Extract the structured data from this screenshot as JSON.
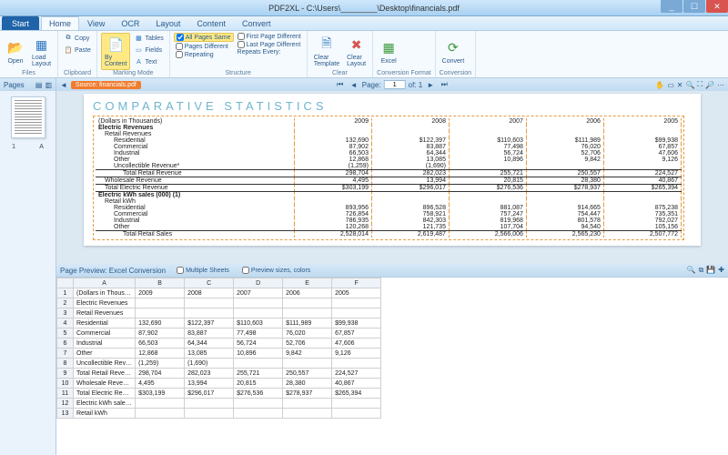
{
  "window": {
    "title": "PDF2XL - C:\\Users\\________\\Desktop\\financials.pdf",
    "min": "_",
    "max": "☐",
    "close": "✕"
  },
  "tabs": {
    "start": "Start",
    "items": [
      "Home",
      "View",
      "OCR",
      "Layout",
      "Content",
      "Convert"
    ],
    "active": 0
  },
  "ribbon": {
    "files": {
      "label": "Files",
      "open": "Open",
      "load": "Load\nLayout"
    },
    "clipboard": {
      "label": "Clipboard",
      "copy": "Copy",
      "paste": "Paste"
    },
    "marking": {
      "label": "Marking Mode",
      "by": "By\nContent",
      "tables": "Tables",
      "fields": "Fields",
      "text": "Text"
    },
    "structure": {
      "label": "Structure",
      "allSame": "All Pages Same",
      "firstDiff": "First Page Different",
      "pagesDiff": "Pages Different",
      "lastDiff": "Last Page Different",
      "repeating": "Repeating",
      "repeats": "Repeats Every:"
    },
    "clear": {
      "label": "Clear",
      "tmpl": "Clear\nTemplate",
      "layout": "Clear\nLayout"
    },
    "convfmt": {
      "label": "Conversion Format",
      "excel": "Excel"
    },
    "conv": {
      "label": "Conversion",
      "convert": "Convert"
    }
  },
  "side": {
    "title": "Pages",
    "t1": "1",
    "t2": "A"
  },
  "srcbar": {
    "source": "Source: financials.pdf",
    "pageLbl": "Page:",
    "page": "1",
    "of": "of: 1"
  },
  "doc": {
    "heading": "COMPARATIVE STATISTICS",
    "note": "(Dollars in Thousands)",
    "years": [
      "2009",
      "2008",
      "2007",
      "2006",
      "2005"
    ],
    "s1": "Electric Revenues",
    "s1a": "Retail Revenues",
    "rows1": [
      {
        "l": "Residential",
        "v": [
          "132,690",
          "$122,397",
          "$110,603",
          "$111,989",
          "$99,938"
        ]
      },
      {
        "l": "Commercial",
        "v": [
          "87,902",
          "83,887",
          "77,498",
          "76,020",
          "67,857"
        ]
      },
      {
        "l": "Industrial",
        "v": [
          "66,503",
          "64,344",
          "56,724",
          "52,706",
          "47,606"
        ]
      },
      {
        "l": "Other",
        "v": [
          "12,868",
          "13,085",
          "10,896",
          "9,842",
          "9,126"
        ]
      },
      {
        "l": "Uncollectible Revenue*",
        "v": [
          "(1,259)",
          "(1,690)",
          "",
          "",
          ""
        ]
      }
    ],
    "tot1": {
      "l": "Total Retail Revenue",
      "v": [
        "298,704",
        "282,023",
        "255,721",
        "250,557",
        "224,527"
      ]
    },
    "whl": {
      "l": "Wholesale Revenue",
      "v": [
        "4,495",
        "13,994",
        "20,815",
        "28,380",
        "40,867"
      ]
    },
    "ter": {
      "l": "Total Electric Revenue",
      "v": [
        "$303,199",
        "$296,017",
        "$276,536",
        "$278,937",
        "$265,394"
      ]
    },
    "s2": "Electric kWh sales (000) (1)",
    "s2a": "Retail kWh",
    "rows2": [
      {
        "l": "Residential",
        "v": [
          "893,956",
          "896,528",
          "881,087",
          "914,665",
          "875,238"
        ]
      },
      {
        "l": "Commercial",
        "v": [
          "726,854",
          "758,921",
          "757,247",
          "754,447",
          "735,351"
        ]
      },
      {
        "l": "Industrial",
        "v": [
          "786,935",
          "842,303",
          "819,968",
          "801,578",
          "792,027"
        ]
      },
      {
        "l": "Other",
        "v": [
          "120,268",
          "121,735",
          "107,704",
          "94,540",
          "105,156"
        ]
      }
    ],
    "tot2": {
      "l": "Total Retail Sales",
      "v": [
        "2,528,014",
        "2,619,487",
        "2,566,006",
        "2,565,230",
        "2,507,772"
      ]
    }
  },
  "previewHdr": {
    "title": "Page Preview: Excel Conversion",
    "multi": "Multiple Sheets",
    "psc": "Preview sizes, colors"
  },
  "grid": {
    "cols": [
      "A",
      "B",
      "C",
      "D",
      "E",
      "F"
    ],
    "rows": [
      [
        "(Dollars in Thous…",
        "2009",
        "2008",
        "2007",
        "2006",
        "2005"
      ],
      [
        "Electric Revenues",
        "",
        "",
        "",
        "",
        ""
      ],
      [
        "Retail Revenues",
        "",
        "",
        "",
        "",
        ""
      ],
      [
        "Residential",
        "132,690",
        "$122,397",
        "$110,603",
        "$111,989",
        "$99,938"
      ],
      [
        "Commercial",
        "87,902",
        "83,887",
        "77,498",
        "76,020",
        "67,857"
      ],
      [
        "Industrial",
        "66,503",
        "64,344",
        "56,724",
        "52,706",
        "47,606"
      ],
      [
        "Other",
        "12,868",
        "13,085",
        "10,896",
        "9,842",
        "9,126"
      ],
      [
        "Uncollectible Rev…",
        "(1,259)",
        "(1,690)",
        "",
        "",
        ""
      ],
      [
        "Total Retail Reve…",
        "298,704",
        "282,023",
        "255,721",
        "250,557",
        "224,527"
      ],
      [
        "Wholesale Reve…",
        "4,495",
        "13,994",
        "20,815",
        "28,380",
        "40,867"
      ],
      [
        "Total Electric Re…",
        "$303,199",
        "$296,017",
        "$276,536",
        "$278,937",
        "$265,394"
      ],
      [
        "Electric kWh sale…",
        "",
        "",
        "",
        "",
        ""
      ],
      [
        "Retail kWh",
        "",
        "",
        "",
        "",
        ""
      ]
    ]
  }
}
